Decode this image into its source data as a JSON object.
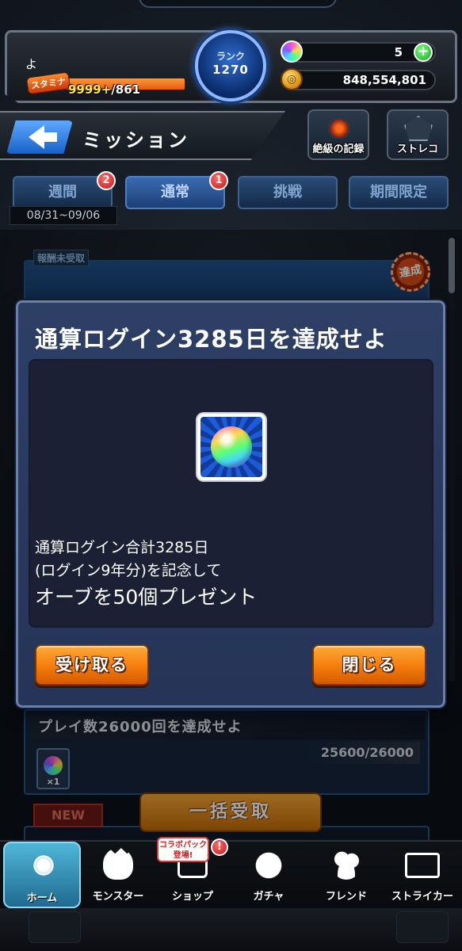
{
  "status": {
    "player_name": "よ",
    "stamina_label": "スタミナ",
    "stamina_current": "9999+",
    "stamina_max": "/861",
    "rank_label": "ランク",
    "rank_value": "1270",
    "orbs": "5",
    "gold": "848,554,801"
  },
  "header": {
    "title": "ミッション",
    "record_icon_label": "絶級の記録",
    "strelo_icon_label": "ストレコ"
  },
  "tabs": [
    {
      "label": "週間",
      "badge": "2"
    },
    {
      "label": "通常",
      "badge": "1"
    },
    {
      "label": "挑戦"
    },
    {
      "label": "期間限定"
    }
  ],
  "date_range": "08/31~09/06",
  "mission_list": {
    "unclaimed_label": "報酬未受取",
    "achieved_stamp": "達成",
    "mission2_title": "プレイ数26000回を達成せよ",
    "mission2_progress": "25600/26000",
    "mission2_reward_qty": "×1",
    "new_label": "NEW",
    "bulk_claim_label": "一括受取"
  },
  "dialog": {
    "title": "通算ログイン3285日を達成せよ",
    "reward_icon": "orb-icon",
    "description_line1": "通算ログイン合計3285日",
    "description_line2": "(ログイン9年分)を記念して",
    "description_line3": "オーブを50個プレゼント",
    "receive_label": "受け取る",
    "close_label": "閉じる"
  },
  "bottom_nav": {
    "collab_badge": "コラボパック\n登場!",
    "alert": "!",
    "items": [
      {
        "label": "ホーム",
        "icon": "home-icon",
        "active": true
      },
      {
        "label": "モンスター",
        "icon": "monster-icon"
      },
      {
        "label": "ショップ",
        "icon": "shop-icon"
      },
      {
        "label": "ガチャ",
        "icon": "gacha-icon"
      },
      {
        "label": "フレンド",
        "icon": "friend-icon"
      },
      {
        "label": "ストライカー",
        "icon": "striker-icon"
      }
    ]
  }
}
